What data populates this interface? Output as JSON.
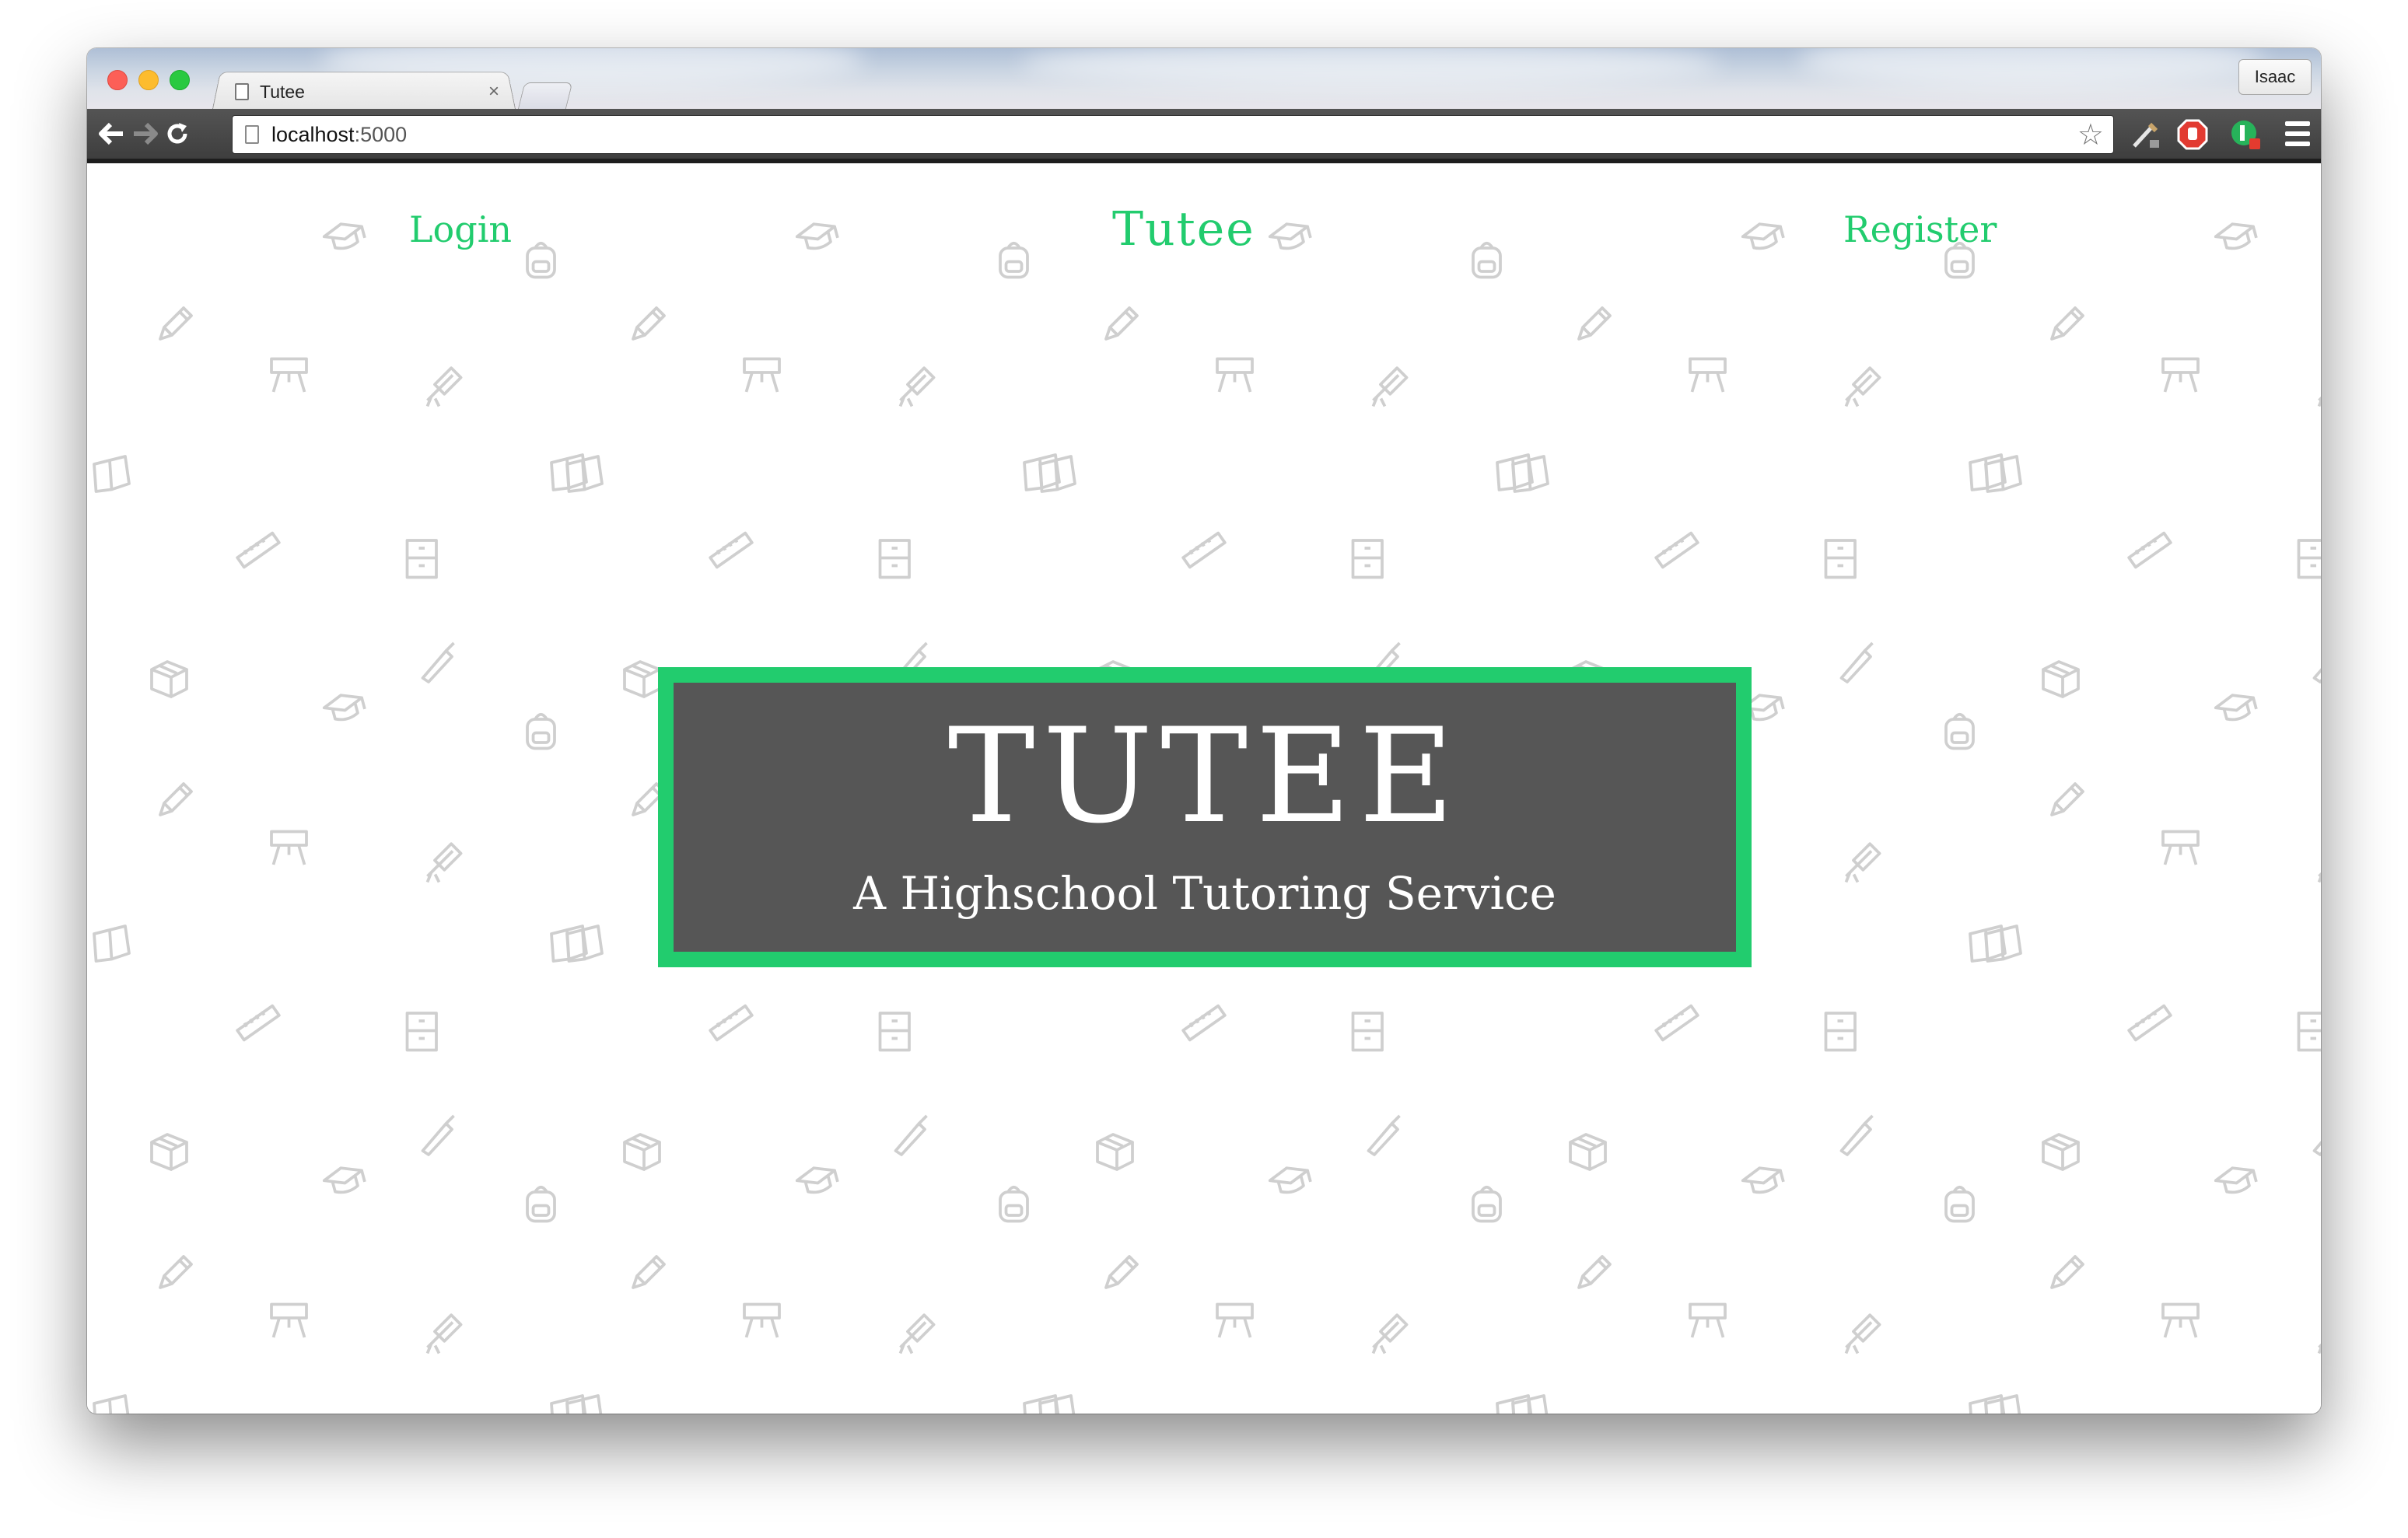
{
  "browser": {
    "tab_title": "Tutee",
    "tab_close": "×",
    "profile_name": "Isaac",
    "url_host": "localhost",
    "url_port": ":5000",
    "star_glyph": "☆",
    "back_glyph": "🡐",
    "forward_glyph": "🡒",
    "reload_glyph": "↻"
  },
  "nav": {
    "login": "Login",
    "brand": "Tutee",
    "register": "Register"
  },
  "hero": {
    "title": "TUTEE",
    "subtitle": "A Highschool Tutoring Service"
  },
  "colors": {
    "accent": "#22cc6e",
    "hero_bg": "#565656",
    "pattern": "#cfcfcf"
  },
  "pattern_icons": [
    "graduation-cap-icon",
    "backpack-icon",
    "pencil-icon",
    "easel-icon",
    "diploma-icon",
    "book-icon",
    "ruler-icon",
    "cabinet-icon",
    "pen-icon",
    "box-icon"
  ]
}
